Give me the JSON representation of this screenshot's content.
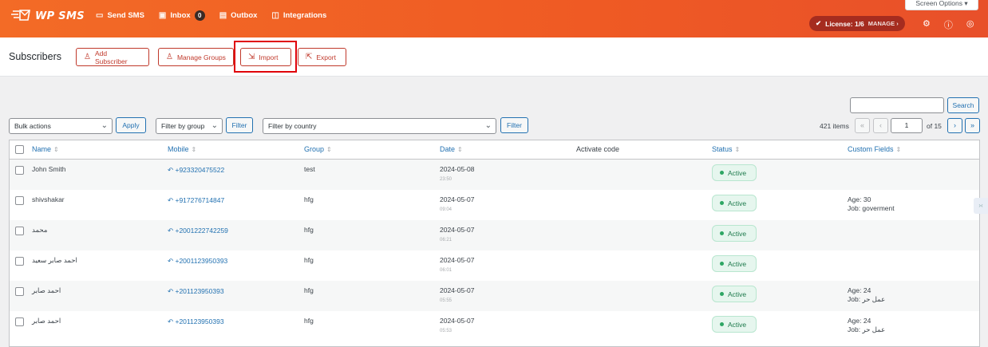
{
  "app": {
    "logo_text": "WP SMS",
    "nav": [
      {
        "label": "Send SMS",
        "icon": "send-icon"
      },
      {
        "label": "Inbox",
        "icon": "inbox-icon",
        "badge": "0"
      },
      {
        "label": "Outbox",
        "icon": "outbox-icon"
      },
      {
        "label": "Integrations",
        "icon": "integrations-icon"
      }
    ],
    "screen_options": "Screen Options ▾",
    "license": {
      "label": "License: 1/6",
      "manage": "MANAGE ›"
    },
    "top_icons": [
      "gear-icon",
      "help-icon",
      "notifications-icon"
    ],
    "colors": {
      "brand": "#f36b26",
      "accent": "#c0392b",
      "link": "#2271b1",
      "status_active": "#2ea664"
    }
  },
  "header": {
    "title": "Subscribers",
    "buttons": [
      {
        "label": "Add Subscriber",
        "icon": "add-user-icon"
      },
      {
        "label": "Manage Groups",
        "icon": "users-icon"
      },
      {
        "label": "Import",
        "icon": "import-icon"
      },
      {
        "label": "Export",
        "icon": "export-icon"
      }
    ]
  },
  "controls": {
    "search_button": "Search",
    "search_value": "",
    "bulk_actions": "Bulk actions",
    "apply": "Apply",
    "filter_group": "Filter by group",
    "filter": "Filter",
    "filter_country": "Filter by country",
    "filter2": "Filter",
    "items_count": "421 items",
    "page_current": "1",
    "page_total": "of 15",
    "pager": {
      "first": "«",
      "prev": "‹",
      "next": "›",
      "last": "»"
    }
  },
  "table": {
    "columns": [
      "Name",
      "Mobile",
      "Group",
      "Date",
      "Activate code",
      "Status",
      "Custom Fields"
    ],
    "rows": [
      {
        "name": "John Smith",
        "mobile": "+923320475522",
        "group": "test",
        "date": "2024-05-08",
        "time": "23:50",
        "status": "Active",
        "cf1": "",
        "cf2": ""
      },
      {
        "name": "shivshakar",
        "mobile": "+917276714847",
        "group": "hfg",
        "date": "2024-05-07",
        "time": "09:04",
        "status": "Active",
        "cf1": "Age: 30",
        "cf2": "Job: goverment"
      },
      {
        "name": "محمد",
        "mobile": "+2001222742259",
        "group": "hfg",
        "date": "2024-05-07",
        "time": "06:21",
        "status": "Active",
        "cf1": "",
        "cf2": ""
      },
      {
        "name": "احمد صابر سعيد",
        "mobile": "+2001123950393",
        "group": "hfg",
        "date": "2024-05-07",
        "time": "06:01",
        "status": "Active",
        "cf1": "",
        "cf2": ""
      },
      {
        "name": "احمد صابر",
        "mobile": "+201123950393",
        "group": "hfg",
        "date": "2024-05-07",
        "time": "05:55",
        "status": "Active",
        "cf1": "Age: 24",
        "cf2": "Job: عمل حر"
      },
      {
        "name": "احمد صابر",
        "mobile": "+201123950393",
        "group": "hfg",
        "date": "2024-05-07",
        "time": "05:53",
        "status": "Active",
        "cf1": "Age: 24",
        "cf2": "Job: عمل حر"
      }
    ]
  }
}
